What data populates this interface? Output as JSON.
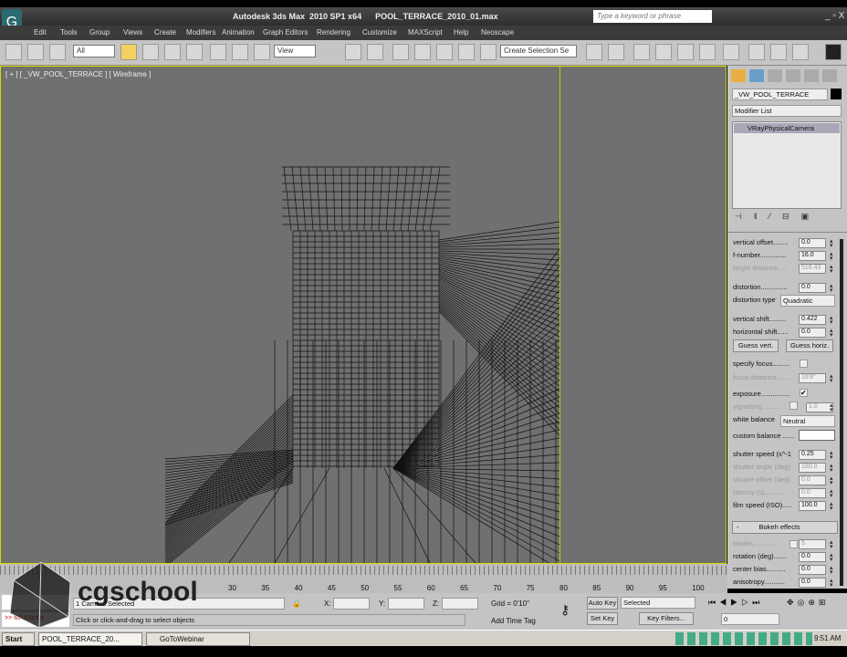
{
  "title": "Autodesk 3ds Max  2010 SP1 x64      POOL_TERRACE_2010_01.max",
  "search_placeholder": "Type a keyword or phrase",
  "menu": [
    "Edit",
    "Tools",
    "Group",
    "Views",
    "Create",
    "Modifiers",
    "Animation",
    "Graph Editors",
    "Rendering",
    "Customize",
    "MAXScript",
    "Help",
    "Neoscape"
  ],
  "toolbar": {
    "filter": "All",
    "ref_coord": "View",
    "selection_set": "Create Selection Se"
  },
  "viewport": {
    "label": "[ + ] [ _VW_POOL_TERRACE ] [ Wireframe ]"
  },
  "panel": {
    "object_name": "_VW_POOL_TERRACE",
    "modifier_list": "Modifier List",
    "stack_item": "VRayPhysicalCamera",
    "params": [
      {
        "label": "vertical offset........",
        "value": "0.0",
        "enabled": true
      },
      {
        "label": "f-number..............",
        "value": "16.0",
        "enabled": true
      },
      {
        "label": "target distance.....",
        "value": "516.43",
        "enabled": false
      },
      {
        "label": "distortion..............",
        "value": "0.0",
        "enabled": true
      },
      {
        "label": "vertical shift.........",
        "value": "0.422",
        "enabled": true
      },
      {
        "label": "horizontal shift......",
        "value": "0.0",
        "enabled": true
      },
      {
        "label": "focus distance.......",
        "value": "16'8\"",
        "enabled": false
      },
      {
        "label": "vignetting.........",
        "value": "1.0",
        "enabled": false
      },
      {
        "label": "shutter speed (s^-1",
        "value": "0.25",
        "enabled": true
      },
      {
        "label": "shutter angle (deg)",
        "value": "180.0",
        "enabled": false
      },
      {
        "label": "shutter offset (deg)",
        "value": "0.0",
        "enabled": false
      },
      {
        "label": "latency (s)...........",
        "value": "0.0",
        "enabled": false
      },
      {
        "label": "film speed (ISO).....",
        "value": "100.0",
        "enabled": true
      },
      {
        "label": "blades.............",
        "value": "5",
        "enabled": false
      },
      {
        "label": "rotation (deg).......",
        "value": "0.0",
        "enabled": true
      },
      {
        "label": "center bias..........",
        "value": "0.0",
        "enabled": true
      },
      {
        "label": "anisotropy...........",
        "value": "0.0",
        "enabled": true
      }
    ],
    "distortion_type_label": "distortion type",
    "distortion_type": "Quadratic",
    "guess_vert": "Guess vert.",
    "guess_horiz": "Guess horiz.",
    "specify_focus": "specify focus.........",
    "exposure": "exposure...............",
    "white_balance_label": "white balance",
    "white_balance": "Neutral",
    "custom_balance": "custom balance ......",
    "bokeh": "Bokeh effects",
    "bokeh_toggle": "-"
  },
  "timeline": {
    "ticks": [
      "30",
      "35",
      "40",
      "45",
      "50",
      "55",
      "60",
      "65",
      "70",
      "75",
      "80",
      "85",
      "90",
      "95",
      "100"
    ]
  },
  "status": {
    "selected": "1 Camera Selected",
    "prompt": "Click or click-and-drag to select objects",
    "x_label": "X:",
    "y_label": "Y:",
    "z_label": "Z:",
    "grid": "Grid = 0'10\"",
    "add_time_tag": "Add Time Tag",
    "auto_key": "Auto Key",
    "set_key": "Set Key",
    "key_mode": "Selected",
    "key_filters": "Key Filters...",
    "frame": "0",
    "maxscript": ">> MAXScript"
  },
  "watermark": "cgschool",
  "taskbar": {
    "start": "Start",
    "tasks": [
      "POOL_TERRACE_20...",
      "GoToWebinar"
    ],
    "clock": "9:51 AM"
  }
}
